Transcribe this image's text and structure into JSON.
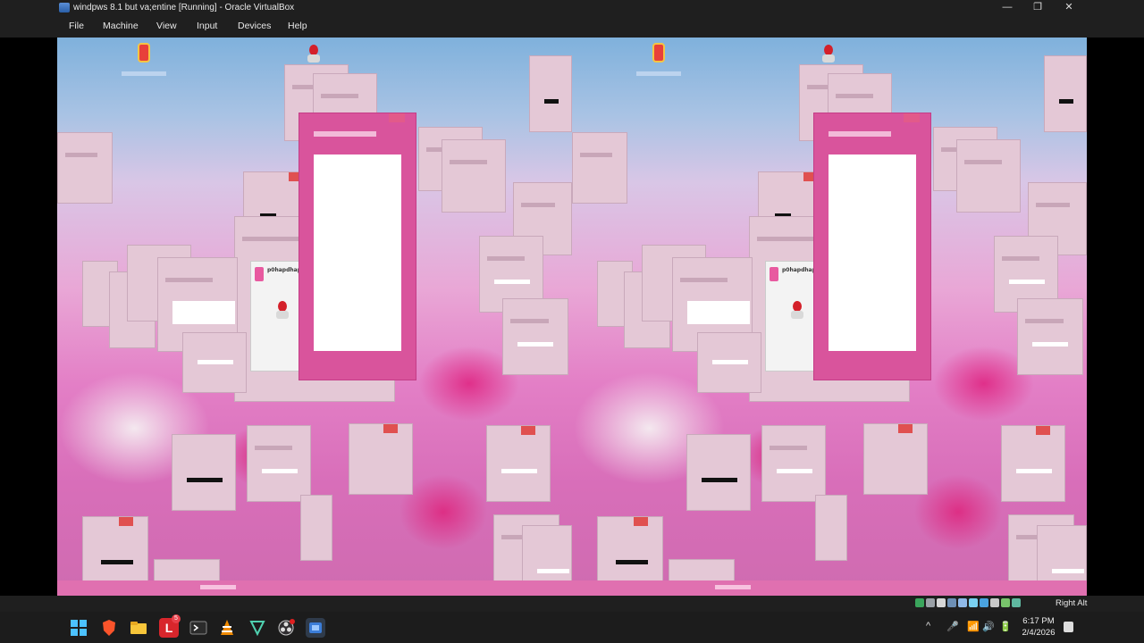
{
  "window": {
    "title": "windpws 8.1 but va;entine [Running] - Oracle VirtualBox",
    "minimize_glyph": "—",
    "restore_glyph": "❐",
    "close_glyph": "✕"
  },
  "menu": {
    "items": [
      "File",
      "Machine",
      "View",
      "Input",
      "Devices",
      "Help"
    ]
  },
  "guest": {
    "dialog_text": "p0hapdhapdhr"
  },
  "statusbar": {
    "host_key": "Right Alt",
    "icons": [
      "disk-icon",
      "optical-icon",
      "audio-icon",
      "network-icon",
      "usb-icon",
      "shared-folder-icon",
      "display-icon",
      "recording-icon",
      "cpu-icon",
      "mouse-integration-icon"
    ]
  },
  "taskbar": {
    "apps": [
      "start-icon",
      "brave-icon",
      "file-explorer-icon",
      "l-app-icon",
      "terminal-icon",
      "vlc-icon",
      "visual-studio-code-icon",
      "obs-icon",
      "virtualbox-icon"
    ],
    "l_app_badge": "5",
    "tray": {
      "chevron": "^",
      "mic": "🎤",
      "wifi": "📶",
      "volume": "🔊",
      "battery": "🔋"
    },
    "clock": {
      "time": "6:17 PM",
      "date": "2/4/2026"
    }
  },
  "colors": {
    "guest_accent": "#d9549c",
    "host_chrome": "#1f1f1f",
    "taskbar": "#1c1c1c"
  }
}
